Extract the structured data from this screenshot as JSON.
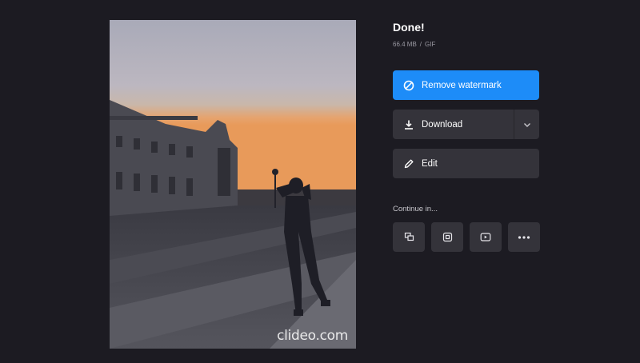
{
  "preview": {
    "watermark": "clideo.com"
  },
  "result": {
    "title": "Done!",
    "size": "66.4 MB",
    "separator": "/",
    "format": "GIF"
  },
  "actions": {
    "remove_watermark": "Remove watermark",
    "download": "Download",
    "edit": "Edit"
  },
  "continue": {
    "label": "Continue in...",
    "tools": [
      "merge-icon",
      "crop-icon",
      "video-icon",
      "more-icon"
    ]
  },
  "colors": {
    "background": "#1c1b22",
    "primary": "#1d8cf8",
    "button": "#34333a"
  }
}
